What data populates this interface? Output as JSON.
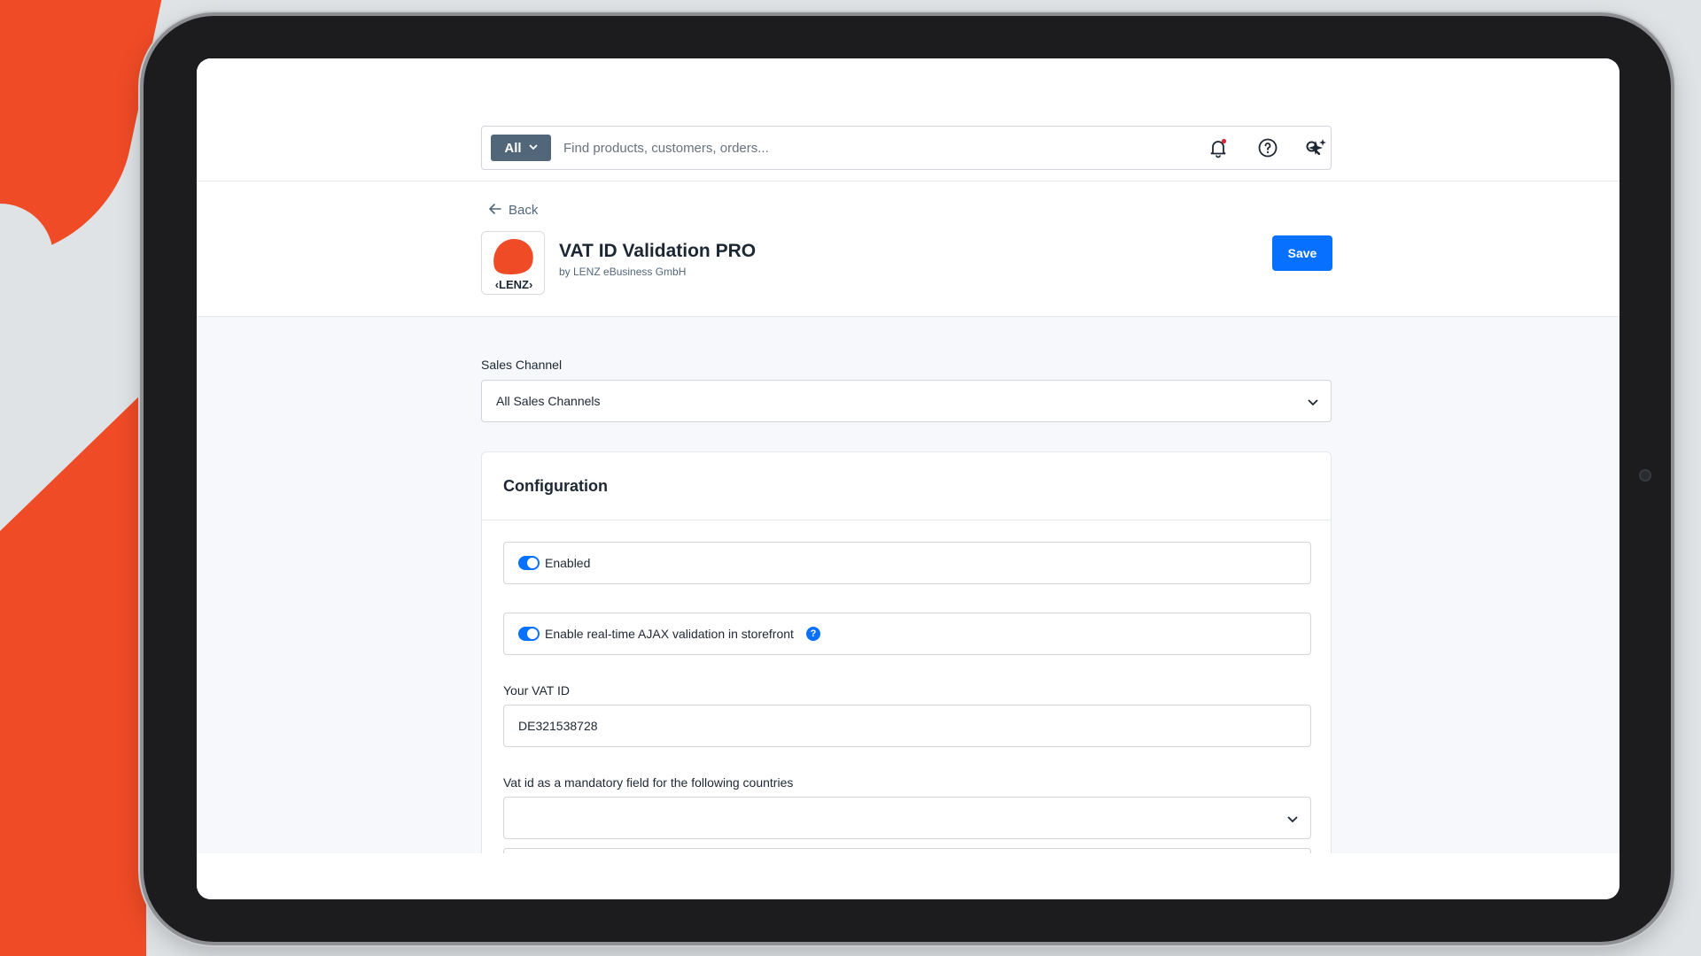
{
  "search": {
    "scope_label": "All",
    "placeholder": "Find products, customers, orders..."
  },
  "header_icons": [
    "bell-icon",
    "help-icon",
    "sparkle-icon"
  ],
  "nav": {
    "back_label": "Back"
  },
  "app": {
    "logo_text": "‹LENZ›",
    "title": "VAT ID Validation PRO",
    "vendor": "by LENZ eBusiness GmbH",
    "save_label": "Save"
  },
  "sales_channel": {
    "label": "Sales Channel",
    "value": "All Sales Channels"
  },
  "configuration": {
    "title": "Configuration",
    "enabled_label": "Enabled",
    "enabled": true,
    "ajax_label": "Enable real-time AJAX validation in storefront",
    "ajax_enabled": true,
    "help_symbol": "?",
    "vat_id_label": "Your VAT ID",
    "vat_id_value": "DE321538728",
    "mandatory_countries_label": "Vat id as a mandatory field for the following countries",
    "mandatory_countries_value": ""
  },
  "colors": {
    "accent": "#0870ff",
    "brand_orange": "#ef4b26",
    "scope_button": "#52667a",
    "notification_dot": "#e0253a"
  }
}
